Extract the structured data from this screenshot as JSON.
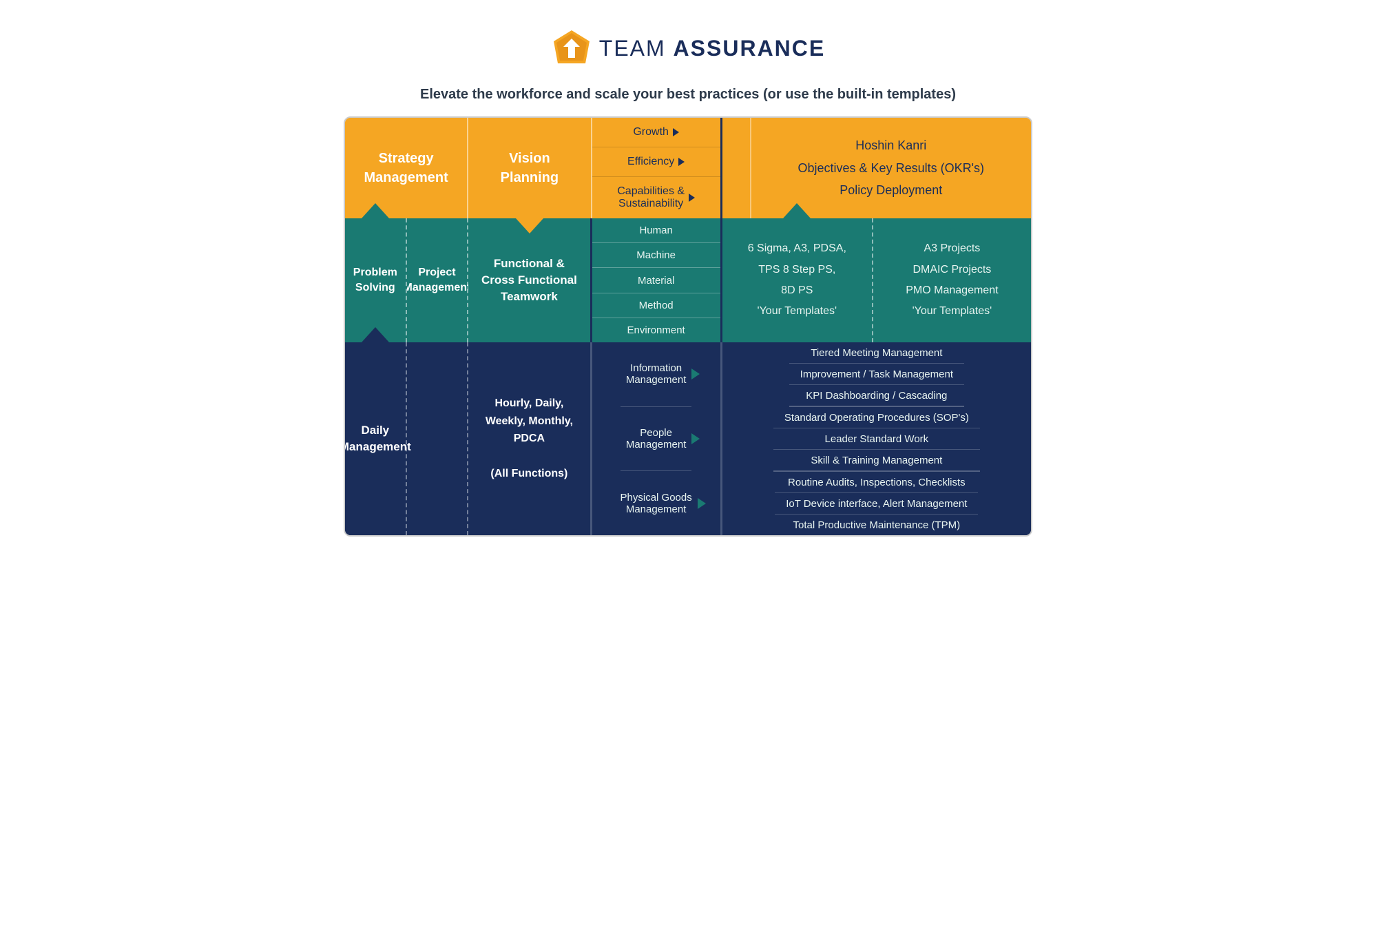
{
  "header": {
    "logo_text_plain": "TEAM ",
    "logo_text_bold": "ASSURANCE",
    "tagline": "Elevate the workforce and scale your best practices (or use the built-in templates)"
  },
  "diagram": {
    "row_orange": {
      "strategy": "Strategy\nManagement",
      "vision": "Vision\nPlanning",
      "growth_items": [
        "Growth",
        "Efficiency",
        "Capabilities &\nSustainability"
      ],
      "hoshin": "Hoshin Kanri\nObjectives & Key Results (OKR's)\nPolicy Deployment"
    },
    "row_teal": {
      "problem": "Problem\nSolving",
      "project": "Project\nManagement",
      "functional": "Functional &\nCross Functional\nTeamwork",
      "ishikawa_items": [
        "Human",
        "Machine",
        "Material",
        "Method",
        "Environment"
      ],
      "sigma": "6 Sigma, A3, PDSA,\nTPS 8 Step PS,\n8D PS\n'Your Templates'",
      "a3": "A3 Projects\nDMAIC Projects\nPMO Management\n'Your Templates'"
    },
    "row_navy": {
      "daily": "Daily\nManagement",
      "hourly": "Hourly, Daily,\nWeekly, Monthly,\nPDCA\n\n(All Functions)",
      "info_mgmt": "Information\nManagement",
      "people_mgmt": "People\nManagement",
      "physical_mgmt": "Physical Goods\nManagement",
      "info_items": [
        "Tiered Meeting Management",
        "Improvement / Task Management",
        "KPI Dashboarding / Cascading"
      ],
      "people_items": [
        "Standard Operating Procedures (SOP's)",
        "Leader Standard Work",
        "Skill & Training Management"
      ],
      "physical_items": [
        "Routine Audits, Inspections, Checklists",
        "IoT Device interface, Alert Management",
        "Total Productive Maintenance (TPM)"
      ]
    }
  }
}
